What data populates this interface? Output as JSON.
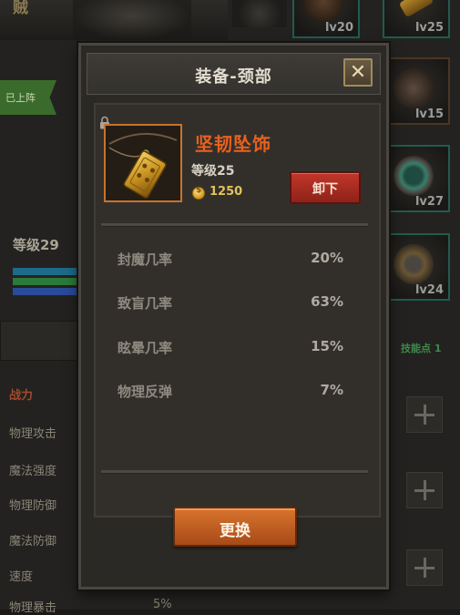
{
  "background": {
    "player_name": "贼",
    "equipped_tag": "已上阵",
    "level_text": "等级29",
    "slots": [
      {
        "level": "lv20",
        "icon": "helmet-icon"
      },
      {
        "level": "lv25",
        "icon": "gold-bar-icon"
      },
      {
        "level": "lv15",
        "icon": "belt-icon"
      },
      {
        "level": "lv27",
        "icon": "emerald-ring-icon"
      },
      {
        "level": "lv24",
        "icon": "shield-icon"
      }
    ],
    "skill_points": "技能点 1",
    "stats": [
      "战力",
      "物理攻击",
      "魔法强度",
      "物理防御",
      "魔法防御",
      "速度",
      "物理暴击"
    ],
    "bottom_value": "5%"
  },
  "modal": {
    "title": "装备-颈部",
    "close_label": "✕",
    "item": {
      "name": "坚韧坠饰",
      "level": "等级25",
      "price": "1250",
      "icon": "gold-pendant-icon",
      "name_color": "#e8611e"
    },
    "unequip_label": "卸下",
    "stats": [
      {
        "label": "封魔几率",
        "value": "20%"
      },
      {
        "label": "致盲几率",
        "value": "63%"
      },
      {
        "label": "眩晕几率",
        "value": "15%"
      },
      {
        "label": "物理反弹",
        "value": "7%"
      }
    ],
    "replace_label": "更换"
  }
}
